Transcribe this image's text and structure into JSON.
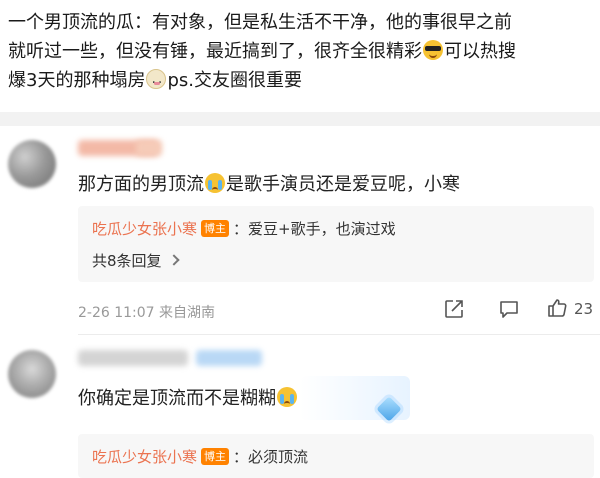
{
  "post": {
    "line1": "一个男顶流的瓜：有对象，但是私生活不干净，他的事很早之前",
    "line2a": "就听过一些，但没有锤，最近搞到了，很齐全很精彩",
    "line2b": "可以热搜",
    "line3a": "爆3天的那种塌房",
    "line3b": "ps.交友圈很重要"
  },
  "comments": [
    {
      "text_a": "那方面的男顶流",
      "text_b": "是歌手演员还是爱豆呢，小寒",
      "reply_author": "吃瓜少女张小寒",
      "reply_badge": "博主",
      "reply_text": "：爱豆+歌手，也演过戏",
      "reply_count": "共8条回复",
      "time_location": "2-26 11:07  来自湖南",
      "likes": "23"
    },
    {
      "text_a": "你确定是顶流而不是糊糊",
      "reply_author": "吃瓜少女张小寒",
      "reply_badge": "博主",
      "reply_text": "：必须顶流"
    }
  ],
  "icons": [
    "sunglasses-emoji",
    "cat-emoji",
    "crying-emoji",
    "share-icon",
    "comment-icon",
    "like-icon",
    "diamond-icon"
  ],
  "colors": {
    "author": "#eb7350",
    "badge": "#ff8200",
    "meta": "#999999",
    "divider": "#f2f2f2"
  }
}
